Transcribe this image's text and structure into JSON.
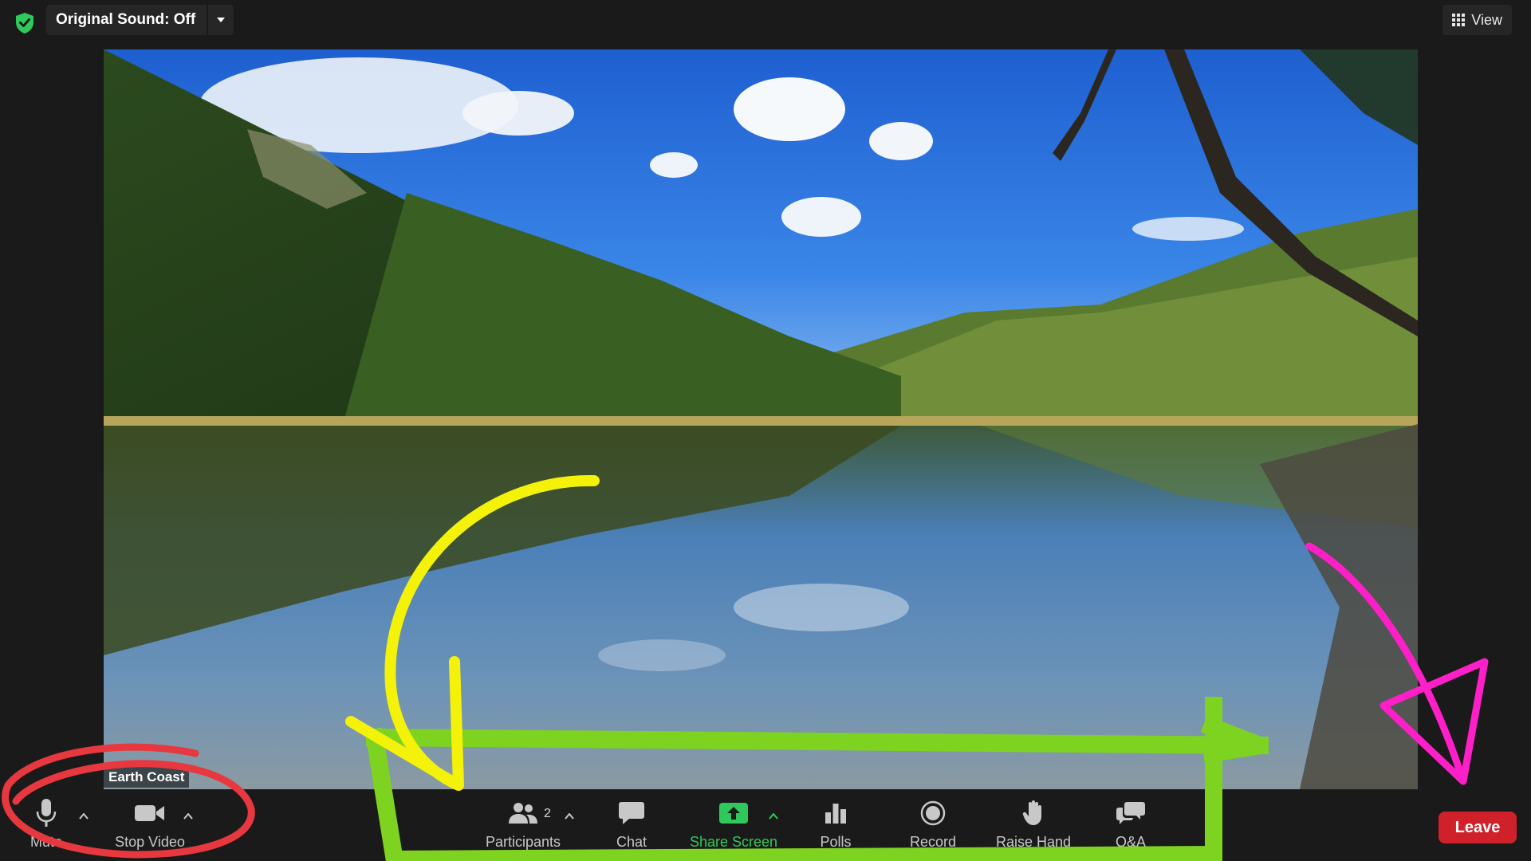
{
  "topbar": {
    "security_icon": "shield-check-icon",
    "original_sound_label": "Original Sound: Off",
    "view_label": "View"
  },
  "video": {
    "participant_name": "Earth Coast"
  },
  "toolbar": {
    "mute_label": "Mute",
    "stop_video_label": "Stop Video",
    "participants_label": "Participants",
    "participants_count": "2",
    "chat_label": "Chat",
    "share_screen_label": "Share Screen",
    "polls_label": "Polls",
    "record_label": "Record",
    "raise_hand_label": "Raise Hand",
    "qa_label": "Q&A",
    "leave_label": "Leave"
  },
  "colors": {
    "share_green": "#2fc95b",
    "leave_red": "#d0212b",
    "annotation_red": "#e8383f",
    "annotation_green": "#7ed321",
    "annotation_yellow": "#f5f20a",
    "annotation_magenta": "#ff1fc8"
  }
}
